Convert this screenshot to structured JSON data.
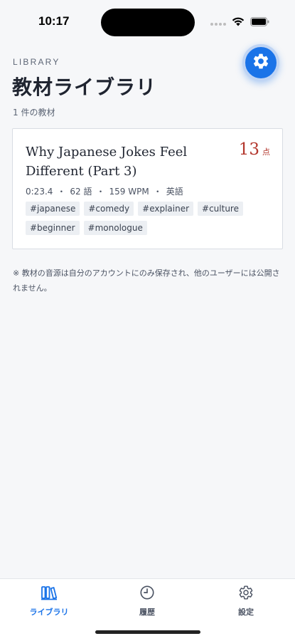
{
  "status_bar": {
    "time": "10:17"
  },
  "header": {
    "eyebrow": "LIBRARY",
    "title": "教材ライブラリ",
    "count_text": "1 件の教材",
    "settings_icon": "gear-icon"
  },
  "library": {
    "items": [
      {
        "title": "Why Japanese Jokes Feel Different (Part 3)",
        "score": "13",
        "score_unit": "点",
        "duration": "0:23.4",
        "words": "62 語",
        "wpm": "159 WPM",
        "language": "英語",
        "tags": [
          "#japanese",
          "#comedy",
          "#explainer",
          "#culture",
          "#beginner",
          "#monologue"
        ]
      }
    ]
  },
  "note": "※ 教材の音源は自分のアカウントにのみ保存され、他のユーザーには公開されません。",
  "tab_bar": {
    "tabs": [
      {
        "label": "ライブラリ",
        "icon": "library-icon",
        "active": true
      },
      {
        "label": "履歴",
        "icon": "clock-icon",
        "active": false
      },
      {
        "label": "設定",
        "icon": "gear-icon",
        "active": false
      }
    ]
  },
  "colors": {
    "accent": "#1a73e8",
    "score": "#b3372d",
    "background": "#f6f7f9"
  }
}
